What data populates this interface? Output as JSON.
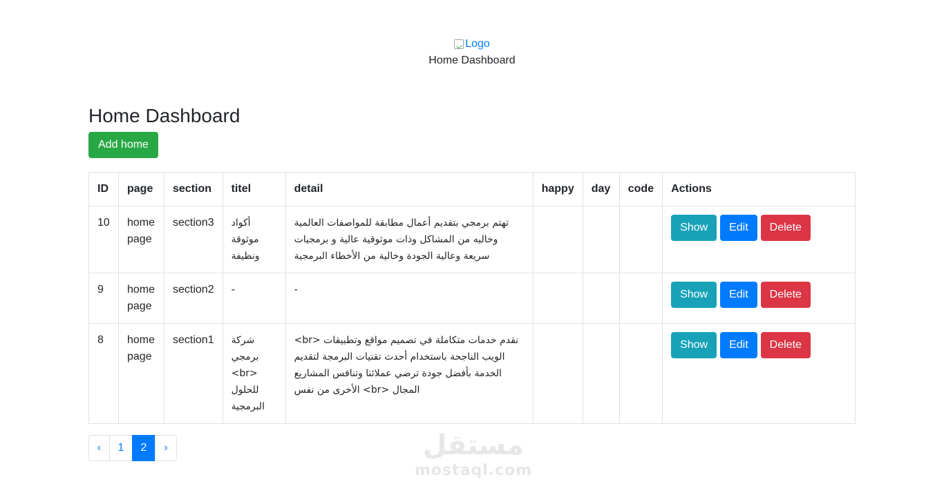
{
  "header": {
    "logo_alt": "Logo",
    "title": "Home Dashboard"
  },
  "main": {
    "heading": "Home Dashboard",
    "add_button": "Add home"
  },
  "table": {
    "columns": [
      "ID",
      "page",
      "section",
      "titel",
      "detail",
      "happy",
      "day",
      "code",
      "Actions"
    ],
    "rows": [
      {
        "id": "10",
        "page": "home page",
        "section": "section3",
        "titel": "أكواد موثوقة ونظيفة",
        "detail": "تهتم برمجي بتقديم أعمال مطابقة للمواصفات العالمية وخاليه من المشاكل وذات موثوقية عالية و برمجيات سريعة وعالية الجودة وخالية من الأخطاء البرمجية",
        "happy": "",
        "day": "",
        "code": ""
      },
      {
        "id": "9",
        "page": "home page",
        "section": "section2",
        "titel": "-",
        "detail": "-",
        "happy": "",
        "day": "",
        "code": ""
      },
      {
        "id": "8",
        "page": "home page",
        "section": "section1",
        "titel": "شركة برمجي <br> للحلول البرمجية",
        "detail": "<br> نقدم خدمات متكاملة في تصميم مواقع وتطبيقات الويب الناجحة باستخدام أحدث تقنيات البرمجة لتقديم الخدمة بأفضل جودة ترضي عملائنا وتنافس المشاريع الأخرى من نفس <br> المجال",
        "happy": "",
        "day": "",
        "code": ""
      }
    ],
    "actions": {
      "show": "Show",
      "edit": "Edit",
      "delete": "Delete"
    }
  },
  "pagination": {
    "prev": "‹",
    "pages": [
      "1",
      "2"
    ],
    "active_page": "2",
    "next": "›"
  },
  "watermark": {
    "arabic": "مستقل",
    "latin": "mostaql.com"
  },
  "colors": {
    "primary": "#007bff",
    "success": "#28a745",
    "info": "#17a2b8",
    "danger": "#dc3545",
    "border": "#dee2e6"
  }
}
